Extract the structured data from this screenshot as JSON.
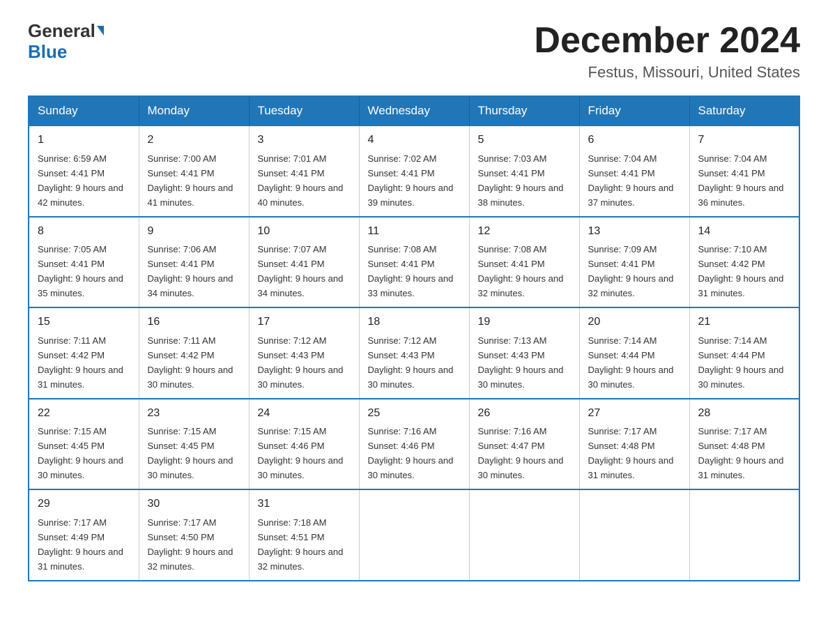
{
  "header": {
    "logo_general": "General",
    "logo_blue": "Blue",
    "month_title": "December 2024",
    "location": "Festus, Missouri, United States"
  },
  "days_of_week": [
    "Sunday",
    "Monday",
    "Tuesday",
    "Wednesday",
    "Thursday",
    "Friday",
    "Saturday"
  ],
  "weeks": [
    [
      {
        "day": "1",
        "sunrise": "6:59 AM",
        "sunset": "4:41 PM",
        "daylight": "9 hours and 42 minutes."
      },
      {
        "day": "2",
        "sunrise": "7:00 AM",
        "sunset": "4:41 PM",
        "daylight": "9 hours and 41 minutes."
      },
      {
        "day": "3",
        "sunrise": "7:01 AM",
        "sunset": "4:41 PM",
        "daylight": "9 hours and 40 minutes."
      },
      {
        "day": "4",
        "sunrise": "7:02 AM",
        "sunset": "4:41 PM",
        "daylight": "9 hours and 39 minutes."
      },
      {
        "day": "5",
        "sunrise": "7:03 AM",
        "sunset": "4:41 PM",
        "daylight": "9 hours and 38 minutes."
      },
      {
        "day": "6",
        "sunrise": "7:04 AM",
        "sunset": "4:41 PM",
        "daylight": "9 hours and 37 minutes."
      },
      {
        "day": "7",
        "sunrise": "7:04 AM",
        "sunset": "4:41 PM",
        "daylight": "9 hours and 36 minutes."
      }
    ],
    [
      {
        "day": "8",
        "sunrise": "7:05 AM",
        "sunset": "4:41 PM",
        "daylight": "9 hours and 35 minutes."
      },
      {
        "day": "9",
        "sunrise": "7:06 AM",
        "sunset": "4:41 PM",
        "daylight": "9 hours and 34 minutes."
      },
      {
        "day": "10",
        "sunrise": "7:07 AM",
        "sunset": "4:41 PM",
        "daylight": "9 hours and 34 minutes."
      },
      {
        "day": "11",
        "sunrise": "7:08 AM",
        "sunset": "4:41 PM",
        "daylight": "9 hours and 33 minutes."
      },
      {
        "day": "12",
        "sunrise": "7:08 AM",
        "sunset": "4:41 PM",
        "daylight": "9 hours and 32 minutes."
      },
      {
        "day": "13",
        "sunrise": "7:09 AM",
        "sunset": "4:41 PM",
        "daylight": "9 hours and 32 minutes."
      },
      {
        "day": "14",
        "sunrise": "7:10 AM",
        "sunset": "4:42 PM",
        "daylight": "9 hours and 31 minutes."
      }
    ],
    [
      {
        "day": "15",
        "sunrise": "7:11 AM",
        "sunset": "4:42 PM",
        "daylight": "9 hours and 31 minutes."
      },
      {
        "day": "16",
        "sunrise": "7:11 AM",
        "sunset": "4:42 PM",
        "daylight": "9 hours and 30 minutes."
      },
      {
        "day": "17",
        "sunrise": "7:12 AM",
        "sunset": "4:43 PM",
        "daylight": "9 hours and 30 minutes."
      },
      {
        "day": "18",
        "sunrise": "7:12 AM",
        "sunset": "4:43 PM",
        "daylight": "9 hours and 30 minutes."
      },
      {
        "day": "19",
        "sunrise": "7:13 AM",
        "sunset": "4:43 PM",
        "daylight": "9 hours and 30 minutes."
      },
      {
        "day": "20",
        "sunrise": "7:14 AM",
        "sunset": "4:44 PM",
        "daylight": "9 hours and 30 minutes."
      },
      {
        "day": "21",
        "sunrise": "7:14 AM",
        "sunset": "4:44 PM",
        "daylight": "9 hours and 30 minutes."
      }
    ],
    [
      {
        "day": "22",
        "sunrise": "7:15 AM",
        "sunset": "4:45 PM",
        "daylight": "9 hours and 30 minutes."
      },
      {
        "day": "23",
        "sunrise": "7:15 AM",
        "sunset": "4:45 PM",
        "daylight": "9 hours and 30 minutes."
      },
      {
        "day": "24",
        "sunrise": "7:15 AM",
        "sunset": "4:46 PM",
        "daylight": "9 hours and 30 minutes."
      },
      {
        "day": "25",
        "sunrise": "7:16 AM",
        "sunset": "4:46 PM",
        "daylight": "9 hours and 30 minutes."
      },
      {
        "day": "26",
        "sunrise": "7:16 AM",
        "sunset": "4:47 PM",
        "daylight": "9 hours and 30 minutes."
      },
      {
        "day": "27",
        "sunrise": "7:17 AM",
        "sunset": "4:48 PM",
        "daylight": "9 hours and 31 minutes."
      },
      {
        "day": "28",
        "sunrise": "7:17 AM",
        "sunset": "4:48 PM",
        "daylight": "9 hours and 31 minutes."
      }
    ],
    [
      {
        "day": "29",
        "sunrise": "7:17 AM",
        "sunset": "4:49 PM",
        "daylight": "9 hours and 31 minutes."
      },
      {
        "day": "30",
        "sunrise": "7:17 AM",
        "sunset": "4:50 PM",
        "daylight": "9 hours and 32 minutes."
      },
      {
        "day": "31",
        "sunrise": "7:18 AM",
        "sunset": "4:51 PM",
        "daylight": "9 hours and 32 minutes."
      },
      null,
      null,
      null,
      null
    ]
  ]
}
